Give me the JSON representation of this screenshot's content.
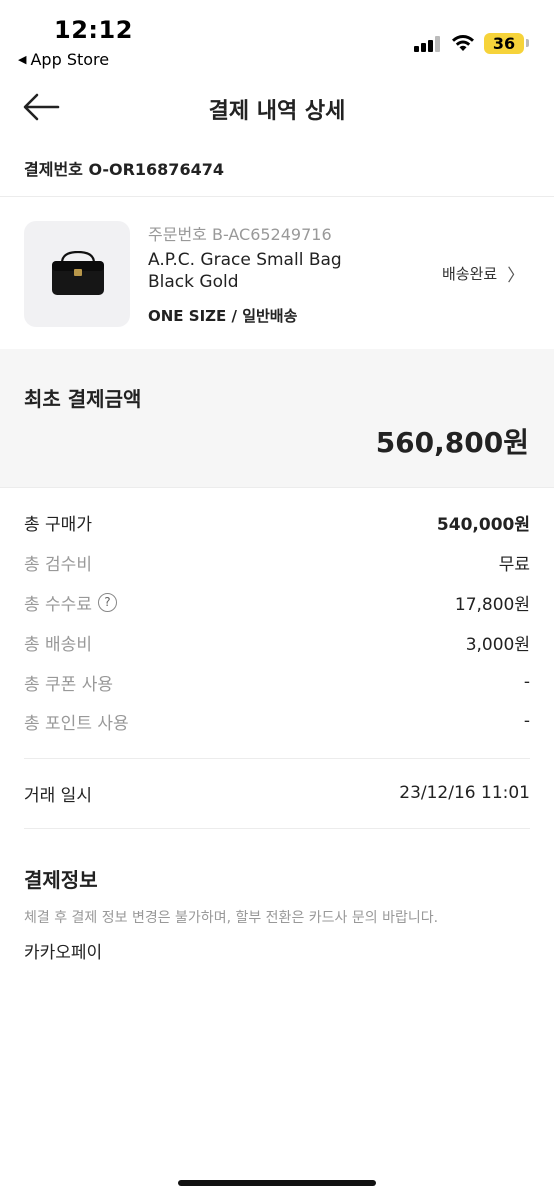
{
  "status_bar": {
    "time": "12:12",
    "back_app": "App Store",
    "battery": "36"
  },
  "nav": {
    "title": "결제 내역 상세"
  },
  "payment_number": "결제번호 O-OR16876474",
  "product": {
    "order_number": "주문번호 B-AC65249716",
    "name_line1": "A.P.C. Grace Small Bag",
    "name_line2": "Black Gold",
    "option": "ONE SIZE / 일반배송",
    "status": "배송완료"
  },
  "amount": {
    "label": "최초 결제금액",
    "value": "560,800원"
  },
  "fees": [
    {
      "label": "총 구매가",
      "value": "540,000원"
    },
    {
      "label": "총 검수비",
      "value": "무료"
    },
    {
      "label": "총 수수료",
      "value": "17,800원"
    },
    {
      "label": "총 배송비",
      "value": "3,000원"
    },
    {
      "label": "총 쿠폰 사용",
      "value": "-"
    },
    {
      "label": "총 포인트 사용",
      "value": "-"
    }
  ],
  "transaction": {
    "label": "거래 일시",
    "value": "23/12/16 11:01"
  },
  "payment_info": {
    "title": "결제정보",
    "notice": "체결 후 결제 정보 변경은 불가하며, 할부 전환은 카드사 문의 바랍니다.",
    "method": "카카오페이"
  },
  "colors": {
    "text_primary": "#222222",
    "text_secondary": "#999999",
    "amount_bg": "#f6f6f6",
    "battery": "#f6d33a"
  }
}
